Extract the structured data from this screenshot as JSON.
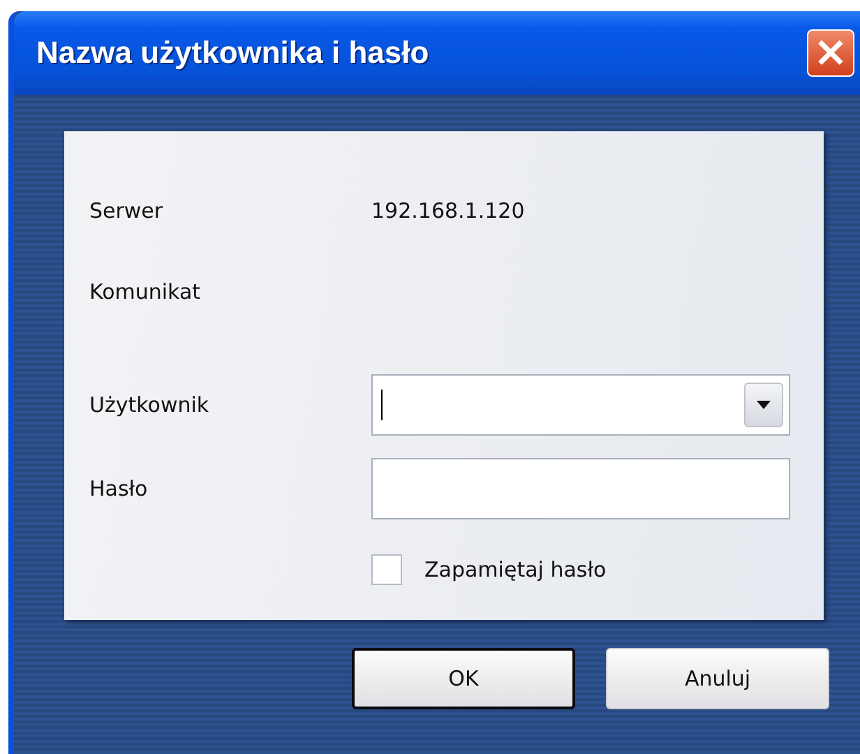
{
  "window": {
    "title": "Nazwa użytkownika i hasło",
    "close": "×"
  },
  "info": [
    {
      "label": "Serwer",
      "value": "192.168.1.120"
    },
    {
      "label": "Komunikat"
    }
  ],
  "fields": [
    {
      "kind": "combo",
      "label": "Użytkownik",
      "focused": true
    },
    {
      "kind": "text",
      "label": "Hasło"
    }
  ],
  "remember": {
    "label": "Zapamiętaj hasło",
    "checked": false
  },
  "buttons": [
    {
      "label": "OK",
      "default": true
    },
    {
      "label": "Anuluj",
      "default": false
    }
  ]
}
